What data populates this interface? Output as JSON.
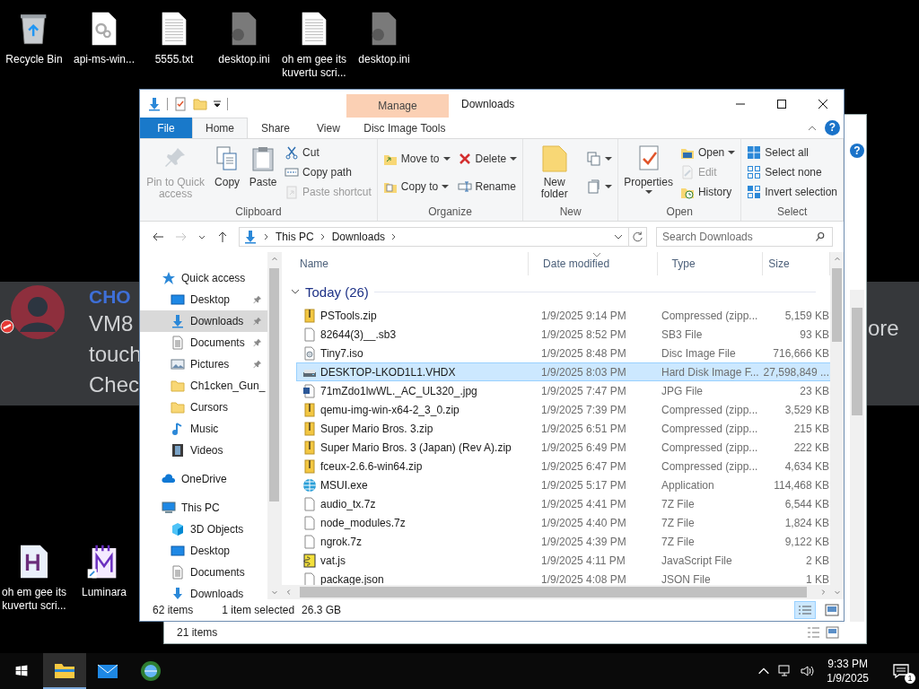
{
  "desktop": {
    "top_icons": [
      {
        "label": "Recycle Bin",
        "kind": "recycle"
      },
      {
        "label": "api-ms-win...",
        "kind": "settings-file"
      },
      {
        "label": "5555.txt",
        "kind": "text"
      },
      {
        "label": "desktop.ini",
        "kind": "ini"
      },
      {
        "label": "oh em gee its kuvertu scri...",
        "kind": "text"
      },
      {
        "label": "desktop.ini",
        "kind": "ini"
      }
    ],
    "bottom_icons": [
      {
        "label": "oh em gee its kuvertu scri...",
        "kind": "h-file"
      },
      {
        "label": "Luminara",
        "kind": "shortcut"
      }
    ]
  },
  "notification": {
    "sender": "CHO",
    "lines": [
      "VM8",
      "touch",
      "Chec"
    ],
    "overflow_text": "ore"
  },
  "back_window": {
    "help": "?",
    "status": "21 items"
  },
  "window": {
    "title": "Downloads",
    "contextual_header": "Manage",
    "help": "?",
    "tabs": [
      {
        "label": "File",
        "kind": "file",
        "selected": false
      },
      {
        "label": "Home",
        "kind": "tab",
        "selected": true
      },
      {
        "label": "Share",
        "kind": "tab",
        "selected": false
      },
      {
        "label": "View",
        "kind": "tab",
        "selected": false
      },
      {
        "label": "Disc Image Tools",
        "kind": "contextual",
        "selected": false
      }
    ],
    "ribbon": [
      {
        "label": "Clipboard",
        "columns": [
          [
            {
              "label": "Pin to Quick access",
              "kind": "pin",
              "disabled": true,
              "dropdown": false
            }
          ],
          [
            {
              "label": "Copy",
              "kind": "copy",
              "disabled": false,
              "dropdown": false
            }
          ],
          [
            {
              "label": "Paste",
              "kind": "paste",
              "disabled": false,
              "dropdown": false
            }
          ],
          [
            {
              "label": "Cut",
              "kind": "cut",
              "disabled": false,
              "dropdown": false
            },
            {
              "label": "Copy path",
              "kind": "copy-path",
              "disabled": false,
              "dropdown": false
            },
            {
              "label": "Paste shortcut",
              "kind": "paste-shortcut",
              "disabled": true,
              "dropdown": false
            }
          ]
        ]
      },
      {
        "label": "Organize",
        "columns": [
          [
            {
              "label": "Move to",
              "kind": "move",
              "disabled": false,
              "dropdown": true
            },
            {
              "label": "Copy to",
              "kind": "copyto",
              "disabled": false,
              "dropdown": true
            }
          ],
          [
            {
              "label": "Delete",
              "kind": "delete",
              "disabled": false,
              "dropdown": true
            },
            {
              "label": "Rename",
              "kind": "rename",
              "disabled": false,
              "dropdown": false
            }
          ]
        ]
      },
      {
        "label": "New",
        "columns": [
          [
            {
              "label": "New folder",
              "kind": "new-folder",
              "disabled": false,
              "dropdown": false
            }
          ],
          [
            {
              "kind": "new-item",
              "disabled": false,
              "dropdown": true
            },
            {
              "kind": "easy-access",
              "disabled": false,
              "dropdown": true
            }
          ]
        ]
      },
      {
        "label": "Open",
        "columns": [
          [
            {
              "label": "Properties",
              "kind": "properties",
              "disabled": false,
              "dropdown": true
            }
          ],
          [
            {
              "label": "Open",
              "kind": "open",
              "disabled": false,
              "dropdown": true
            },
            {
              "label": "Edit",
              "kind": "edit",
              "disabled": true,
              "dropdown": false
            },
            {
              "label": "History",
              "kind": "history",
              "disabled": false,
              "dropdown": false
            }
          ]
        ]
      },
      {
        "label": "Select",
        "columns": [
          [
            {
              "label": "Select all",
              "kind": "select-all",
              "disabled": false,
              "dropdown": false
            },
            {
              "label": "Select none",
              "kind": "select-none",
              "disabled": false,
              "dropdown": false
            },
            {
              "label": "Invert selection",
              "kind": "invert",
              "disabled": false,
              "dropdown": false
            }
          ]
        ]
      }
    ],
    "address": {
      "path": [
        "This PC",
        "Downloads"
      ],
      "search_placeholder": "Search Downloads"
    },
    "nav_pane": {
      "items": [
        {
          "label": "Quick access",
          "kind": "star",
          "selected": false,
          "pinned": false,
          "children": [
            {
              "label": "Desktop",
              "kind": "desktop",
              "selected": false,
              "pinned": true
            },
            {
              "label": "Downloads",
              "kind": "download",
              "selected": true,
              "pinned": true
            },
            {
              "label": "Documents",
              "kind": "document",
              "selected": false,
              "pinned": true
            },
            {
              "label": "Pictures",
              "kind": "picture",
              "selected": false,
              "pinned": true
            },
            {
              "label": "Ch1cken_Gun_",
              "kind": "folder",
              "selected": false,
              "pinned": false
            },
            {
              "label": "Cursors",
              "kind": "folder",
              "selected": false,
              "pinned": false
            },
            {
              "label": "Music",
              "kind": "music",
              "selected": false,
              "pinned": false
            },
            {
              "label": "Videos",
              "kind": "video",
              "selected": false,
              "pinned": false
            }
          ]
        },
        {
          "label": "OneDrive",
          "kind": "cloud",
          "selected": false,
          "pinned": false
        },
        {
          "label": "This PC",
          "kind": "pc",
          "selected": false,
          "pinned": false,
          "children": [
            {
              "label": "3D Objects",
              "kind": "cube",
              "selected": false,
              "pinned": false
            },
            {
              "label": "Desktop",
              "kind": "desktop",
              "selected": false,
              "pinned": false
            },
            {
              "label": "Documents",
              "kind": "document",
              "selected": false,
              "pinned": false
            },
            {
              "label": "Downloads",
              "kind": "download",
              "selected": false,
              "pinned": false
            }
          ]
        }
      ]
    },
    "columns": [
      {
        "label": "Name",
        "sorted": false
      },
      {
        "label": "Date modified",
        "sorted": true
      },
      {
        "label": "Type",
        "sorted": false
      },
      {
        "label": "Size",
        "sorted": false
      }
    ],
    "group": {
      "label": "Today (26)",
      "expanded": true
    },
    "rows": [
      {
        "name": "PSTools.zip",
        "date": "1/9/2025 9:14 PM",
        "type": "Compressed (zipp...",
        "size": "5,159 KB",
        "kind": "zip",
        "selected": false
      },
      {
        "name": "82644(3)__.sb3",
        "date": "1/9/2025 8:52 PM",
        "type": "SB3 File",
        "size": "93 KB",
        "kind": "blank",
        "selected": false
      },
      {
        "name": "Tiny7.iso",
        "date": "1/9/2025 8:48 PM",
        "type": "Disc Image File",
        "size": "716,666 KB",
        "kind": "disc",
        "selected": false
      },
      {
        "name": "DESKTOP-LKOD1L1.VHDX",
        "date": "1/9/2025 8:03 PM",
        "type": "Hard Disk Image F...",
        "size": "27,598,849 ...",
        "kind": "disk",
        "selected": true
      },
      {
        "name": "71mZdo1lwWL._AC_UL320_.jpg",
        "date": "1/9/2025 7:47 PM",
        "type": "JPG File",
        "size": "23 KB",
        "kind": "image",
        "selected": false
      },
      {
        "name": "qemu-img-win-x64-2_3_0.zip",
        "date": "1/9/2025 7:39 PM",
        "type": "Compressed (zipp...",
        "size": "3,529 KB",
        "kind": "zip",
        "selected": false
      },
      {
        "name": "Super Mario Bros. 3.zip",
        "date": "1/9/2025 6:51 PM",
        "type": "Compressed (zipp...",
        "size": "215 KB",
        "kind": "zip",
        "selected": false
      },
      {
        "name": "Super Mario Bros. 3 (Japan) (Rev A).zip",
        "date": "1/9/2025 6:49 PM",
        "type": "Compressed (zipp...",
        "size": "222 KB",
        "kind": "zip",
        "selected": false
      },
      {
        "name": "fceux-2.6.6-win64.zip",
        "date": "1/9/2025 6:47 PM",
        "type": "Compressed (zipp...",
        "size": "4,634 KB",
        "kind": "zip",
        "selected": false
      },
      {
        "name": "MSUI.exe",
        "date": "1/9/2025 5:17 PM",
        "type": "Application",
        "size": "114,468 KB",
        "kind": "app",
        "selected": false
      },
      {
        "name": "audio_tx.7z",
        "date": "1/9/2025 4:41 PM",
        "type": "7Z File",
        "size": "6,544 KB",
        "kind": "blank",
        "selected": false
      },
      {
        "name": "node_modules.7z",
        "date": "1/9/2025 4:40 PM",
        "type": "7Z File",
        "size": "1,824 KB",
        "kind": "blank",
        "selected": false
      },
      {
        "name": "ngrok.7z",
        "date": "1/9/2025 4:39 PM",
        "type": "7Z File",
        "size": "9,122 KB",
        "kind": "blank",
        "selected": false
      },
      {
        "name": "vat.js",
        "date": "1/9/2025 4:11 PM",
        "type": "JavaScript File",
        "size": "2 KB",
        "kind": "script",
        "selected": false
      },
      {
        "name": "package.json",
        "date": "1/9/2025 4:08 PM",
        "type": "JSON File",
        "size": "1 KB",
        "kind": "blank",
        "selected": false
      }
    ],
    "status": {
      "count": "62 items",
      "selection": "1 item selected",
      "size": "26.3 GB"
    }
  },
  "taskbar": {
    "apps": [
      {
        "kind": "explorer",
        "active": true
      },
      {
        "kind": "mail",
        "active": false
      },
      {
        "kind": "browser",
        "active": false
      }
    ],
    "time": "9:33 PM",
    "date": "1/9/2025",
    "notification_count": "1"
  }
}
